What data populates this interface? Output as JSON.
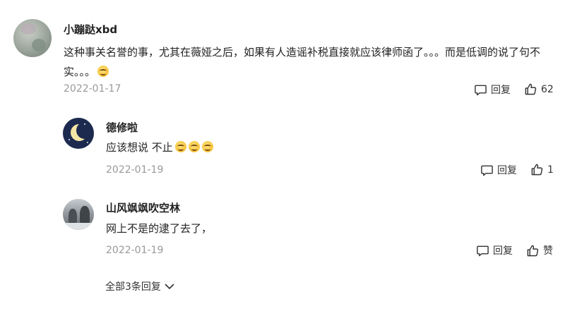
{
  "main_comment": {
    "username": "小蹦跶xbd",
    "text": "这种事关名誉的事，尤其在薇娅之后，如果有人造谣补税直接就应该律师函了。。。而是低调的说了句不实。。。",
    "date": "2022-01-17",
    "reply_label": "回复",
    "like_count": "62"
  },
  "replies": [
    {
      "username": "德修啦",
      "text": "应该想说 不止",
      "date": "2022-01-19",
      "reply_label": "回复",
      "like_count": "1"
    },
    {
      "username": "山风飒飒吹空林",
      "text": "网上不是的逮了去了，",
      "date": "2022-01-19",
      "reply_label": "回复",
      "like_label": "赞"
    }
  ],
  "expand_replies_label": "全部3条回复",
  "icons": [
    "comment-icon",
    "thumbs-up-icon",
    "chevron-down-icon",
    "smile-emoji-icon"
  ]
}
